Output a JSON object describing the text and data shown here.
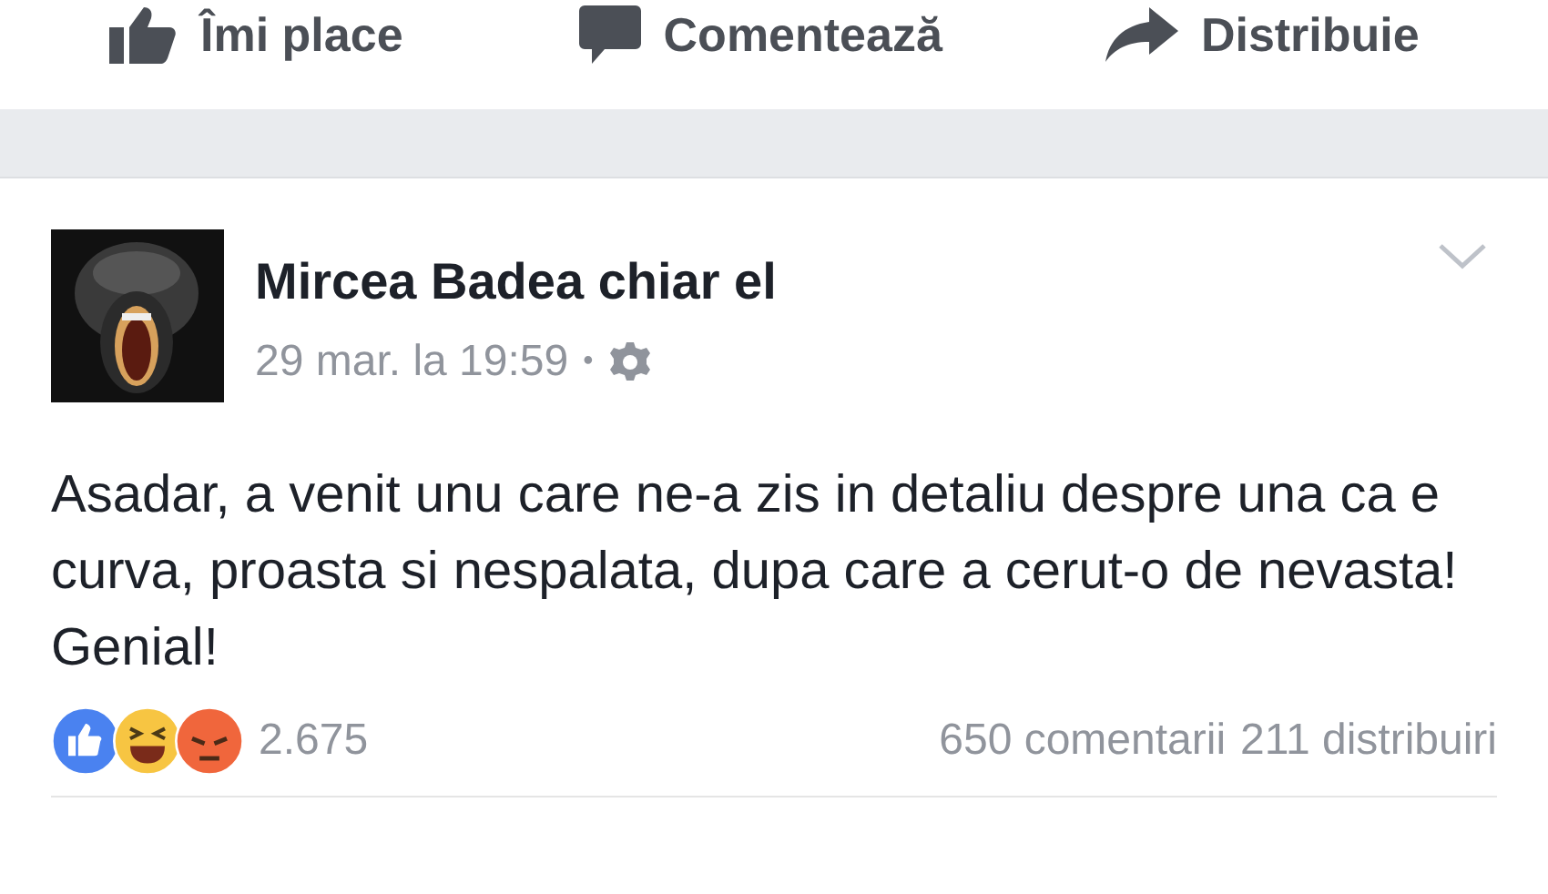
{
  "top_actions": [
    {
      "kind": "like",
      "label": "Îmi place"
    },
    {
      "kind": "comment",
      "label": "Comentează"
    },
    {
      "kind": "share",
      "label": "Distribuie"
    }
  ],
  "post": {
    "author": "Mircea Badea chiar el",
    "time": "29 mar. la 19:59",
    "separator": "•",
    "text": "Asadar, a venit unu care ne-a zis in detaliu despre una ca e curva, proasta si nespalata, dupa care a cerut-o de nevasta! Genial!",
    "reactions": [
      {
        "kind": "like",
        "color": "#4a82f0"
      },
      {
        "kind": "haha",
        "color": "#f7c542"
      },
      {
        "kind": "angry",
        "color": "#f0663c"
      }
    ],
    "reaction_count": "2.675",
    "comments": "650 comentarii",
    "shares": "211 distribuiri"
  }
}
